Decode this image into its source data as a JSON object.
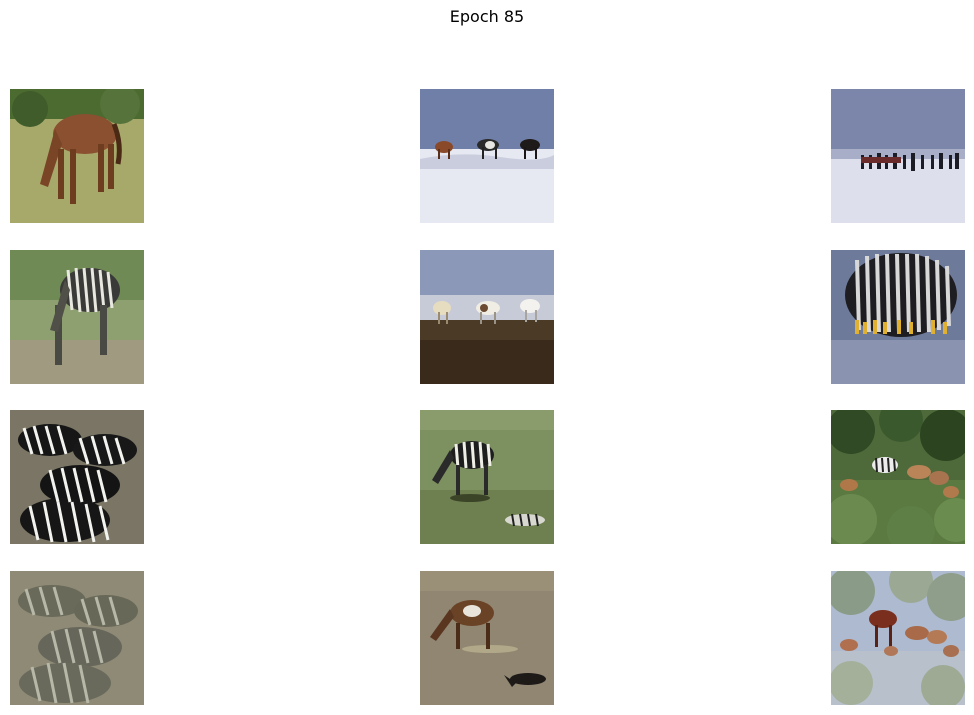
{
  "figure": {
    "title": "Epoch 85"
  },
  "grid": {
    "rows": [
      {
        "tiles": [
          {
            "name": "tile-horse-grazing-grass"
          },
          {
            "name": "tile-three-horses-snow"
          },
          {
            "name": "tile-herd-snowfield"
          }
        ]
      },
      {
        "tiles": [
          {
            "name": "tile-generated-zebra-grazing"
          },
          {
            "name": "tile-generated-horses-shore"
          },
          {
            "name": "tile-generated-zebra-stripes-water"
          }
        ]
      },
      {
        "tiles": [
          {
            "name": "tile-zebra-group"
          },
          {
            "name": "tile-zebra-grazing-field"
          },
          {
            "name": "tile-generated-horses-bushes"
          }
        ]
      },
      {
        "tiles": [
          {
            "name": "tile-reconstructed-zebra-group"
          },
          {
            "name": "tile-generated-horse-field"
          },
          {
            "name": "tile-reconstructed-animals-bushes"
          }
        ]
      }
    ]
  }
}
